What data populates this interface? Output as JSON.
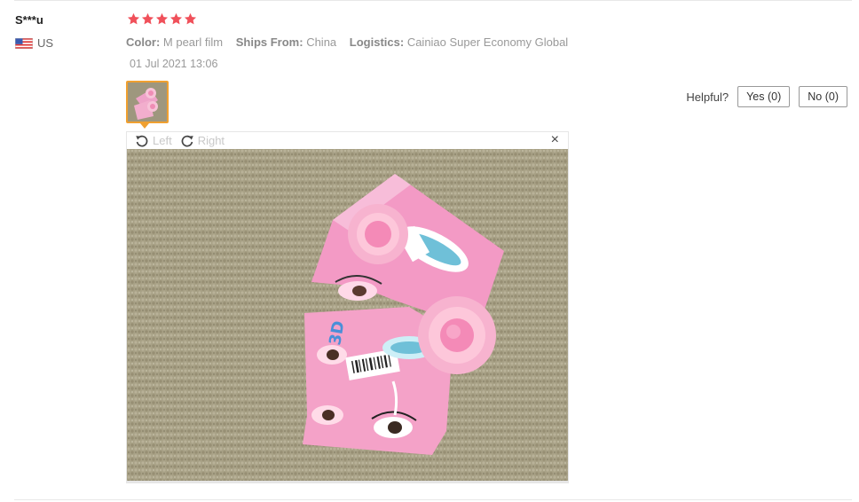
{
  "review": {
    "user": "S***u",
    "country": "US",
    "rating": 5,
    "meta": {
      "color_label": "Color:",
      "color_value": "M pearl film",
      "ships_label": "Ships From:",
      "ships_value": "China",
      "logistics_label": "Logistics:",
      "logistics_value": "Cainiao Super Economy Global"
    },
    "date": "01 Jul 2021 13:06"
  },
  "helpful": {
    "label": "Helpful?",
    "yes": "Yes (0)",
    "no": "No (0)"
  },
  "viewer": {
    "left_label": "Left",
    "right_label": "Right",
    "close": "×"
  },
  "icons": {
    "flag": "us-flag-icon",
    "star": "star-icon",
    "rotate_left": "rotate-left-icon",
    "rotate_right": "rotate-right-icon",
    "close": "close-icon"
  },
  "colors": {
    "star": "#f0505a",
    "thumb_border": "#f0a030",
    "muted_text": "#999999",
    "carpet": "#a59e83",
    "packaging_pink": "#f08ec0"
  }
}
